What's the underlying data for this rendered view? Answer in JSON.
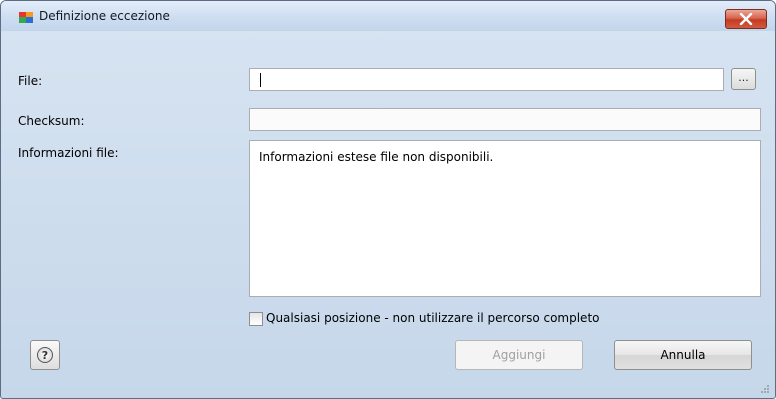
{
  "window": {
    "title": "Definizione eccezione"
  },
  "form": {
    "file_label": "File:",
    "file_value": "",
    "browse_label": "...",
    "checksum_label": "Checksum:",
    "checksum_value": "",
    "info_label": "Informazioni file:",
    "info_text": "Informazioni estese file non disponibili."
  },
  "options": {
    "any_location_label": "Qualsiasi posizione - non utilizzare il percorso completo",
    "any_location_checked": false
  },
  "buttons": {
    "help": "?",
    "add": "Aggiungi",
    "add_enabled": false,
    "cancel": "Annulla"
  },
  "colors": {
    "titlebar": "#cfdff1",
    "close": "#c43b23",
    "client": "#f0f0f0"
  },
  "icons": [
    "avg-app-icon",
    "close-icon",
    "help-icon",
    "resize-grip-icon"
  ]
}
